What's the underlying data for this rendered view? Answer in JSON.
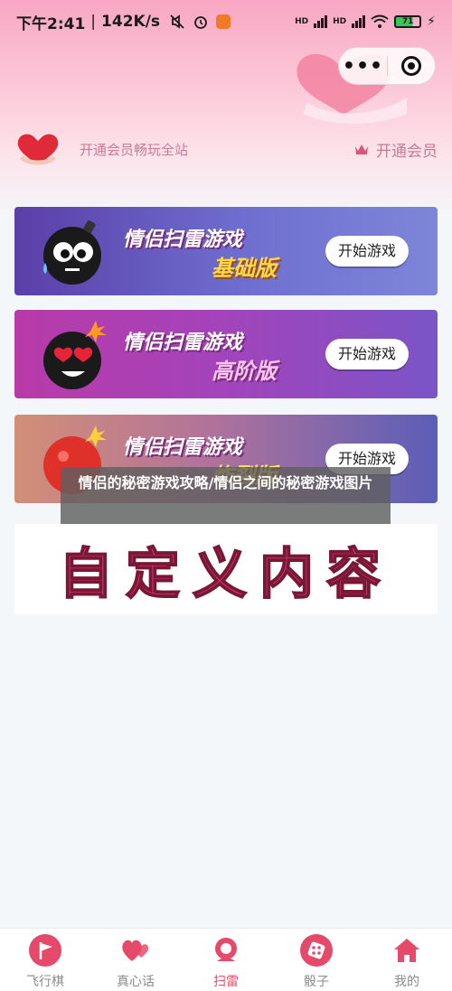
{
  "status_bar": {
    "time": "下午2:41",
    "speed": "142K/s",
    "battery": "71",
    "network_left": "HD",
    "network_right": "HD"
  },
  "colors": {
    "accent": "#e54a6a",
    "member_text": "#c97a96",
    "header_pink": "#f8a7c3"
  },
  "member": {
    "promo_text": "开通会员畅玩全站",
    "button_label": "开通会员"
  },
  "banners": [
    {
      "title": "情侣扫雷游戏",
      "subtitle": "基础版",
      "button": "开始游戏"
    },
    {
      "title": "情侣扫雷游戏",
      "subtitle": "高阶版",
      "button": "开始游戏"
    },
    {
      "title": "情侣扫雷游戏",
      "subtitle": "炸裂版",
      "button": "开始游戏"
    }
  ],
  "overlay": {
    "caption": "情侣的秘密游戏攻略/情侣之间的秘密游戏图片"
  },
  "custom_card": {
    "text": "自定义内容"
  },
  "tabs": [
    {
      "label": "飞行棋",
      "icon": "flag-icon"
    },
    {
      "label": "真心话",
      "icon": "hearts-icon"
    },
    {
      "label": "扫雷",
      "icon": "bomb-icon"
    },
    {
      "label": "骰子",
      "icon": "dice-icon"
    },
    {
      "label": "我的",
      "icon": "home-icon"
    }
  ]
}
